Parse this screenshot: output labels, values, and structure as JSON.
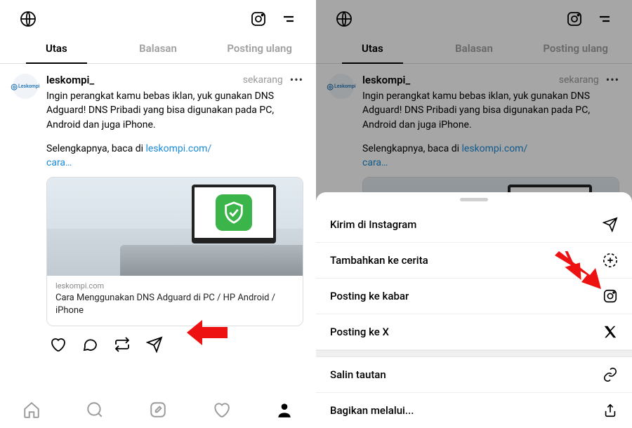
{
  "tabs": {
    "threads": "Utas",
    "replies": "Balasan",
    "reposts": "Posting ulang"
  },
  "post": {
    "username": "leskompi_",
    "avatar_text": "Leskompi",
    "timestamp": "sekarang",
    "text1": "Ingin perangkat kamu bebas iklan, yuk gunakan DNS Adguard! DNS Pribadi yang bisa digunakan pada PC, Android dan juga iPhone.",
    "text2a": "Selengkapnya, baca di ",
    "link1": "leskompi.com/",
    "link2": "cara…",
    "card_domain": "leskompi.com",
    "card_title": "Cara Menggunakan DNS Adguard di PC / HP Android / iPhone"
  },
  "sheet": {
    "send_instagram": "Kirim di Instagram",
    "add_story": "Tambahkan ke cerita",
    "post_feed": "Posting ke kabar",
    "post_x": "Posting ke X",
    "copy_link": "Salin tautan",
    "share_via": "Bagikan melalui..."
  }
}
